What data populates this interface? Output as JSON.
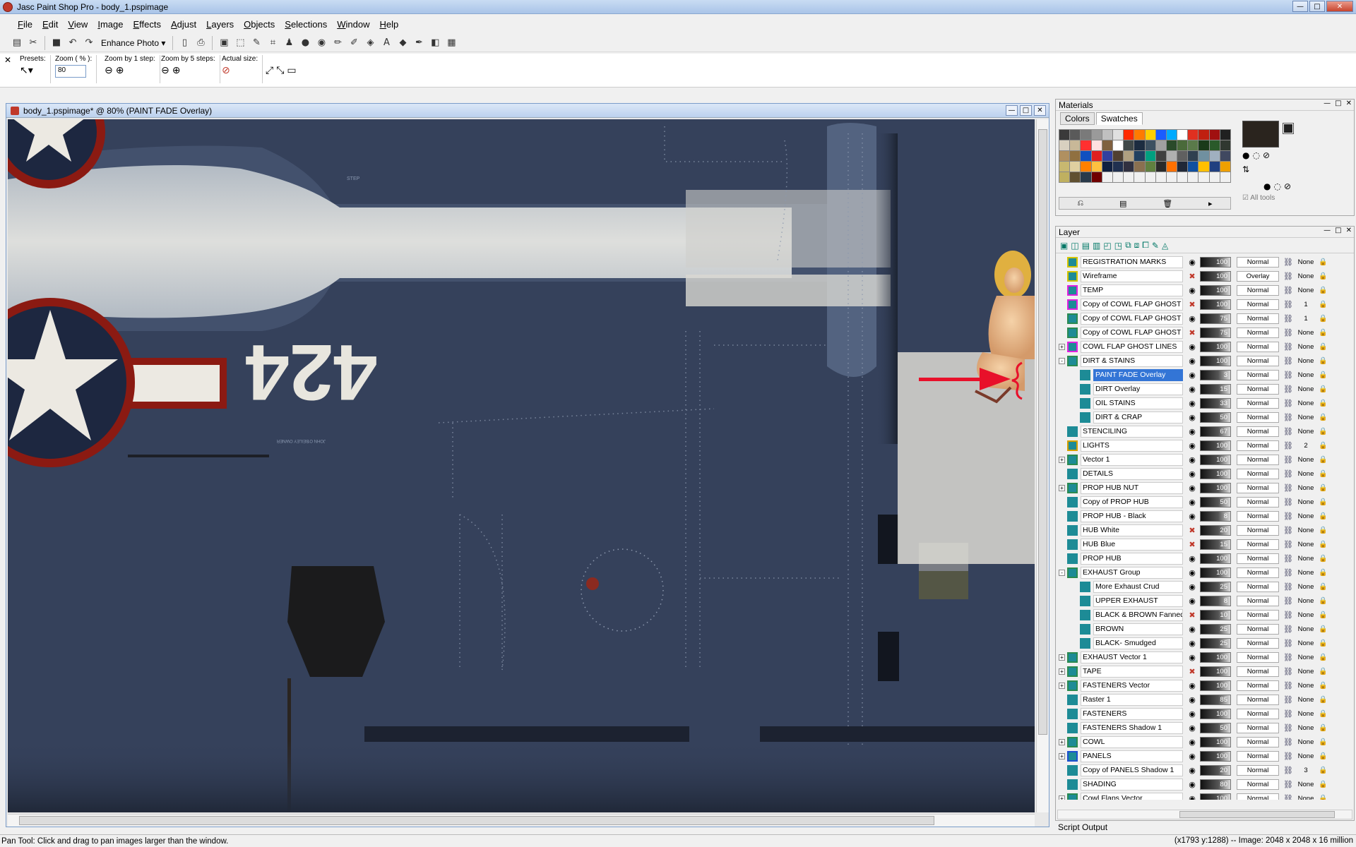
{
  "window": {
    "title": "Jasc Paint Shop Pro - body_1.pspimage"
  },
  "menu": [
    "File",
    "Edit",
    "View",
    "Image",
    "Effects",
    "Adjust",
    "Layers",
    "Objects",
    "Selections",
    "Window",
    "Help"
  ],
  "toolbar": {
    "enhance_photo": "Enhance Photo"
  },
  "tool_options": {
    "presets_label": "Presets:",
    "zoom_label": "Zoom ( % ):",
    "zoom_value": "80",
    "zoom1_label": "Zoom by 1 step:",
    "zoom5_label": "Zoom by 5 steps:",
    "actual_label": "Actual size:"
  },
  "document": {
    "title": "body_1.pspimage* @  80% (PAINT FADE Overlay)",
    "tail_number": "424",
    "marking_step": "STEP",
    "marking_owner": "JOHN O'BEILEY OWNER"
  },
  "materials": {
    "title": "Materials",
    "tab_colors": "Colors",
    "tab_swatches": "Swatches",
    "all_tools": "All tools",
    "swatches": [
      "#3a3a3a",
      "#5a5a5a",
      "#7a7a7a",
      "#9a9a9a",
      "#c0c0c0",
      "#e0e0e0",
      "#ff2a00",
      "#ff7b00",
      "#ffd000",
      "#1a5cff",
      "#00aaff",
      "#ffffff",
      "#e03020",
      "#c02010",
      "#a01010",
      "#202020",
      "#d8d0c0",
      "#c8b898",
      "#ff3030",
      "#ffe0e0",
      "#806040",
      "#ffffff",
      "#404848",
      "#1c2c40",
      "#3c5060",
      "#a0a0a0",
      "#2a4a2a",
      "#4a6a3a",
      "#5a7a4a",
      "#1a3a1a",
      "#2a5a2a",
      "#303830",
      "#b09060",
      "#907040",
      "#1050c0",
      "#e02020",
      "#3040a0",
      "#504030",
      "#b0a080",
      "#204060",
      "#00a080",
      "#404040",
      "#b0b0b0",
      "#606060",
      "#304050",
      "#7090a0",
      "#a0b0c0",
      "#404860",
      "#c8b870",
      "#e0d0a0",
      "#ff8000",
      "#ffc040",
      "#102040",
      "#203050",
      "#303040",
      "#8a7050",
      "#608040",
      "#2a2a2a",
      "#ff7000",
      "#202838",
      "#1050a0",
      "#ffc000",
      "#204080",
      "#f0a000",
      "#bfb060",
      "#605030",
      "#2a3a4a",
      "#700000",
      "#f0f0f0",
      "#f0f0f0",
      "#f0f0f0",
      "#f0f0f0",
      "#f0f0f0",
      "#f0f0f0",
      "#f0f0f0",
      "#f0f0f0",
      "#f0f0f0",
      "#f0f0f0",
      "#f0f0f0",
      "#f0f0f0"
    ],
    "fg_color": "#2a241e",
    "bg_color": "#222222"
  },
  "layers": {
    "title": "Layer",
    "rows": [
      {
        "name": "REGISTRATION MARKS",
        "indent": 0,
        "expander": "",
        "icon": "#d4c400",
        "eye": "on",
        "opacity": "100",
        "blend": "Normal",
        "link": "",
        "mask": "None"
      },
      {
        "name": "Wireframe",
        "indent": 0,
        "expander": "",
        "icon": "#d4c400",
        "eye": "off",
        "opacity": "100",
        "blend": "Overlay",
        "link": "",
        "mask": "None"
      },
      {
        "name": "TEMP",
        "indent": 0,
        "expander": "",
        "icon": "#e020e0",
        "eye": "on",
        "opacity": "100",
        "blend": "Normal",
        "link": "",
        "mask": "None"
      },
      {
        "name": "Copy of COWL FLAP GHOST LINES",
        "indent": 0,
        "expander": "",
        "icon": "#e020e0",
        "eye": "off",
        "opacity": "100",
        "blend": "Normal",
        "link": "1",
        "mask": "1"
      },
      {
        "name": "Copy of COWL FLAP GHOST LINES",
        "indent": 0,
        "expander": "",
        "icon": "#2a8a50",
        "eye": "on",
        "opacity": "75",
        "blend": "Normal",
        "link": "1",
        "mask": "1"
      },
      {
        "name": "Copy of COWL FLAP GHOST LINES",
        "indent": 0,
        "expander": "",
        "icon": "#2a8a50",
        "eye": "off",
        "opacity": "75",
        "blend": "Normal",
        "link": "",
        "mask": "None"
      },
      {
        "name": "COWL FLAP GHOST LINES",
        "indent": 0,
        "expander": "+",
        "icon": "#e020e0",
        "eye": "on",
        "opacity": "100",
        "blend": "Normal",
        "link": "",
        "mask": "None"
      },
      {
        "name": "DIRT & STAINS",
        "indent": 0,
        "expander": "-",
        "icon": "#2a8a50",
        "eye": "on",
        "opacity": "100",
        "blend": "Normal",
        "link": "",
        "mask": "None"
      },
      {
        "name": "PAINT FADE Overlay",
        "indent": 1,
        "expander": "",
        "icon": "#1d8b96",
        "eye": "on",
        "opacity": "3",
        "blend": "Normal",
        "link": "",
        "mask": "None",
        "selected": true
      },
      {
        "name": "DIRT Overlay",
        "indent": 1,
        "expander": "",
        "icon": "#1d8b96",
        "eye": "on",
        "opacity": "15",
        "blend": "Normal",
        "link": "",
        "mask": "None"
      },
      {
        "name": "OIL STAINS",
        "indent": 1,
        "expander": "",
        "icon": "#1d8b96",
        "eye": "on",
        "opacity": "33",
        "blend": "Normal",
        "link": "",
        "mask": "None"
      },
      {
        "name": "DIRT & CRAP",
        "indent": 1,
        "expander": "",
        "icon": "#1d8b96",
        "eye": "on",
        "opacity": "50",
        "blend": "Normal",
        "link": "",
        "mask": "None"
      },
      {
        "name": "STENCILING",
        "indent": 0,
        "expander": "",
        "icon": "#1d8b96",
        "eye": "on",
        "opacity": "67",
        "blend": "Normal",
        "link": "",
        "mask": "None"
      },
      {
        "name": "LIGHTS",
        "indent": 0,
        "expander": "",
        "icon": "#d4a000",
        "eye": "on",
        "opacity": "100",
        "blend": "Normal",
        "link": "2",
        "mask": "2"
      },
      {
        "name": "Vector 1",
        "indent": 0,
        "expander": "+",
        "icon": "#2a8a50",
        "eye": "on",
        "opacity": "100",
        "blend": "Normal",
        "link": "",
        "mask": "None"
      },
      {
        "name": "DETAILS",
        "indent": 0,
        "expander": "",
        "icon": "#1d8b96",
        "eye": "on",
        "opacity": "100",
        "blend": "Normal",
        "link": "",
        "mask": "None"
      },
      {
        "name": "PROP HUB NUT",
        "indent": 0,
        "expander": "+",
        "icon": "#2a8a50",
        "eye": "on",
        "opacity": "100",
        "blend": "Normal",
        "link": "",
        "mask": "None"
      },
      {
        "name": "Copy of PROP HUB",
        "indent": 0,
        "expander": "",
        "icon": "#1d8b96",
        "eye": "on",
        "opacity": "50",
        "blend": "Normal",
        "link": "",
        "mask": "None"
      },
      {
        "name": "PROP HUB - Black",
        "indent": 0,
        "expander": "",
        "icon": "#1d8b96",
        "eye": "on",
        "opacity": "8",
        "blend": "Normal",
        "link": "",
        "mask": "None"
      },
      {
        "name": "HUB White",
        "indent": 0,
        "expander": "",
        "icon": "#1d8b96",
        "eye": "off",
        "opacity": "20",
        "blend": "Normal",
        "link": "",
        "mask": "None"
      },
      {
        "name": "HUB Blue",
        "indent": 0,
        "expander": "",
        "icon": "#1d8b96",
        "eye": "off",
        "opacity": "15",
        "blend": "Normal",
        "link": "",
        "mask": "None"
      },
      {
        "name": "PROP HUB",
        "indent": 0,
        "expander": "",
        "icon": "#1d8b96",
        "eye": "on",
        "opacity": "100",
        "blend": "Normal",
        "link": "",
        "mask": "None"
      },
      {
        "name": "EXHAUST Group",
        "indent": 0,
        "expander": "-",
        "icon": "#2a8a50",
        "eye": "on",
        "opacity": "100",
        "blend": "Normal",
        "link": "",
        "mask": "None"
      },
      {
        "name": "More Exhaust Crud",
        "indent": 1,
        "expander": "",
        "icon": "#1d8b96",
        "eye": "on",
        "opacity": "25",
        "blend": "Normal",
        "link": "",
        "mask": "None"
      },
      {
        "name": "UPPER EXHAUST",
        "indent": 1,
        "expander": "",
        "icon": "#1d8b96",
        "eye": "on",
        "opacity": "8",
        "blend": "Normal",
        "link": "",
        "mask": "None"
      },
      {
        "name": "BLACK & BROWN Fanned out",
        "indent": 1,
        "expander": "",
        "icon": "#1d8b96",
        "eye": "off",
        "opacity": "10",
        "blend": "Normal",
        "link": "",
        "mask": "None"
      },
      {
        "name": "BROWN",
        "indent": 1,
        "expander": "",
        "icon": "#1d8b96",
        "eye": "on",
        "opacity": "25",
        "blend": "Normal",
        "link": "",
        "mask": "None"
      },
      {
        "name": "BLACK- Smudged",
        "indent": 1,
        "expander": "",
        "icon": "#1d8b96",
        "eye": "on",
        "opacity": "25",
        "blend": "Normal",
        "link": "",
        "mask": "None"
      },
      {
        "name": "EXHAUST Vector 1",
        "indent": 0,
        "expander": "+",
        "icon": "#2a8a50",
        "eye": "on",
        "opacity": "100",
        "blend": "Normal",
        "link": "",
        "mask": "None"
      },
      {
        "name": "TAPE",
        "indent": 0,
        "expander": "+",
        "icon": "#2a8a50",
        "eye": "off",
        "opacity": "100",
        "blend": "Normal",
        "link": "",
        "mask": "None"
      },
      {
        "name": "FASTENERS Vector",
        "indent": 0,
        "expander": "+",
        "icon": "#2a8a50",
        "eye": "on",
        "opacity": "100",
        "blend": "Normal",
        "link": "",
        "mask": "None"
      },
      {
        "name": "Raster 1",
        "indent": 0,
        "expander": "",
        "icon": "#1d8b96",
        "eye": "on",
        "opacity": "85",
        "blend": "Normal",
        "link": "",
        "mask": "None"
      },
      {
        "name": "FASTENERS",
        "indent": 0,
        "expander": "",
        "icon": "#1d8b96",
        "eye": "on",
        "opacity": "100",
        "blend": "Normal",
        "link": "",
        "mask": "None"
      },
      {
        "name": "FASTENERS Shadow 1",
        "indent": 0,
        "expander": "",
        "icon": "#1d8b96",
        "eye": "on",
        "opacity": "50",
        "blend": "Normal",
        "link": "",
        "mask": "None"
      },
      {
        "name": "COWL",
        "indent": 0,
        "expander": "+",
        "icon": "#2a8a50",
        "eye": "on",
        "opacity": "100",
        "blend": "Normal",
        "link": "",
        "mask": "None"
      },
      {
        "name": "PANELS",
        "indent": 0,
        "expander": "+",
        "icon": "#1d4fd0",
        "eye": "on",
        "opacity": "100",
        "blend": "Normal",
        "link": "",
        "mask": "None"
      },
      {
        "name": "Copy of PANELS Shadow 1",
        "indent": 0,
        "expander": "",
        "icon": "#1d8b96",
        "eye": "on",
        "opacity": "20",
        "blend": "Normal",
        "link": "3",
        "mask": "3"
      },
      {
        "name": "SHADING",
        "indent": 0,
        "expander": "",
        "icon": "#1d8b96",
        "eye": "on",
        "opacity": "80",
        "blend": "Normal",
        "link": "",
        "mask": "None"
      },
      {
        "name": "Cowl Flaps Vector",
        "indent": 0,
        "expander": "+",
        "icon": "#2a8a50",
        "eye": "on",
        "opacity": "100",
        "blend": "Normal",
        "link": "",
        "mask": "None"
      }
    ]
  },
  "script_output": "Script Output",
  "status": {
    "left": "Pan Tool: Click and drag to pan images larger than the window.",
    "right": "(x1793 y:1288) -- Image:  2048 x 2048 x 16 million"
  }
}
